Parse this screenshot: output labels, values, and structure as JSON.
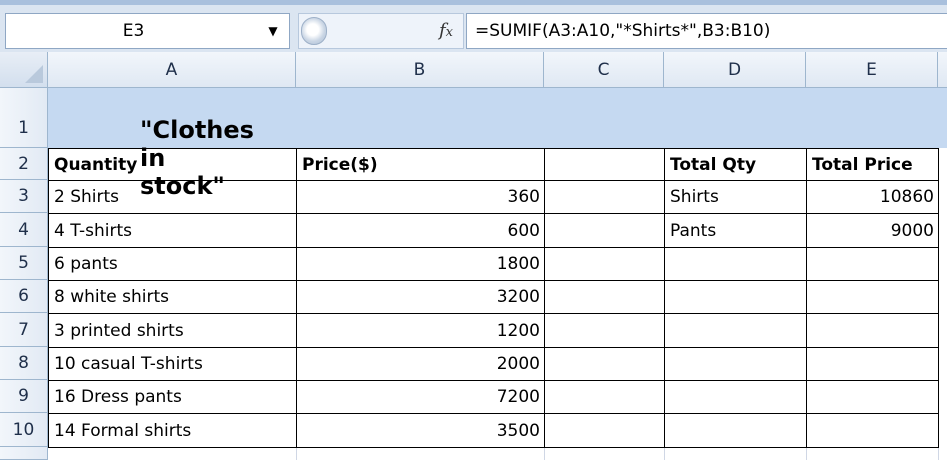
{
  "name_box": {
    "value": "E3"
  },
  "formula_bar": {
    "fx_label": "fx",
    "formula": "=SUMIF(A3:A10,\"*Shirts*\",B3:B10)"
  },
  "columns": [
    "A",
    "B",
    "C",
    "D",
    "E"
  ],
  "rows": [
    "1",
    "2",
    "3",
    "4",
    "5",
    "6",
    "7",
    "8",
    "9",
    "10"
  ],
  "title": "\"Clothes in stock\"",
  "table": {
    "headers": {
      "quantity": "Quantity",
      "price": "Price($)"
    },
    "items": [
      {
        "quantity": "2 Shirts",
        "price": "360"
      },
      {
        "quantity": "4 T-shirts",
        "price": "600"
      },
      {
        "quantity": "6 pants",
        "price": "1800"
      },
      {
        "quantity": "8 white shirts",
        "price": "3200"
      },
      {
        "quantity": "3 printed shirts",
        "price": "1200"
      },
      {
        "quantity": "10 casual T-shirts",
        "price": "2000"
      },
      {
        "quantity": "16 Dress pants",
        "price": "7200"
      },
      {
        "quantity": "14 Formal shirts",
        "price": "3500"
      }
    ]
  },
  "summary": {
    "headers": {
      "qty": "Total Qty",
      "price": "Total Price"
    },
    "rows": [
      {
        "qty": "Shirts",
        "price": "10860"
      },
      {
        "qty": "Pants",
        "price": "9000"
      }
    ]
  },
  "colors": {
    "row1_fill": "#c5d9f1",
    "header_fill": "#dfe8f3",
    "formula_bar_bg": "#dbe5f1"
  }
}
